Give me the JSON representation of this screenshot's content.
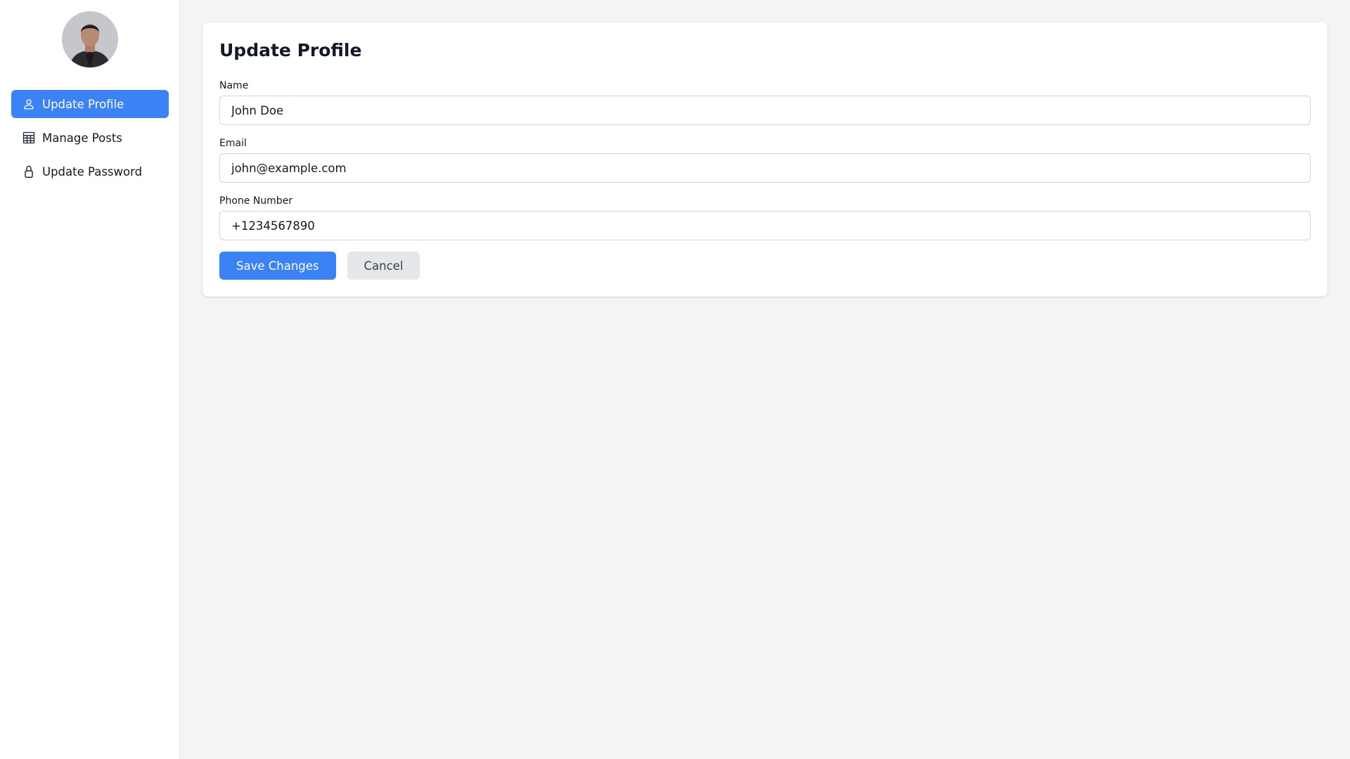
{
  "sidebar": {
    "avatar_icon": "user-avatar-photo",
    "items": [
      {
        "label": "Update Profile",
        "icon": "user-icon",
        "active": true
      },
      {
        "label": "Manage Posts",
        "icon": "table-icon",
        "active": false
      },
      {
        "label": "Update Password",
        "icon": "lock-icon",
        "active": false
      }
    ]
  },
  "form": {
    "title": "Update Profile",
    "name": {
      "label": "Name",
      "value": "John Doe"
    },
    "email": {
      "label": "Email",
      "value": "john@example.com"
    },
    "phone": {
      "label": "Phone Number",
      "value": "+1234567890"
    },
    "save_label": "Save Changes",
    "cancel_label": "Cancel"
  },
  "colors": {
    "accent": "#3b82f6",
    "background": "#f3f4f6",
    "secondary_button": "#e5e7eb"
  }
}
